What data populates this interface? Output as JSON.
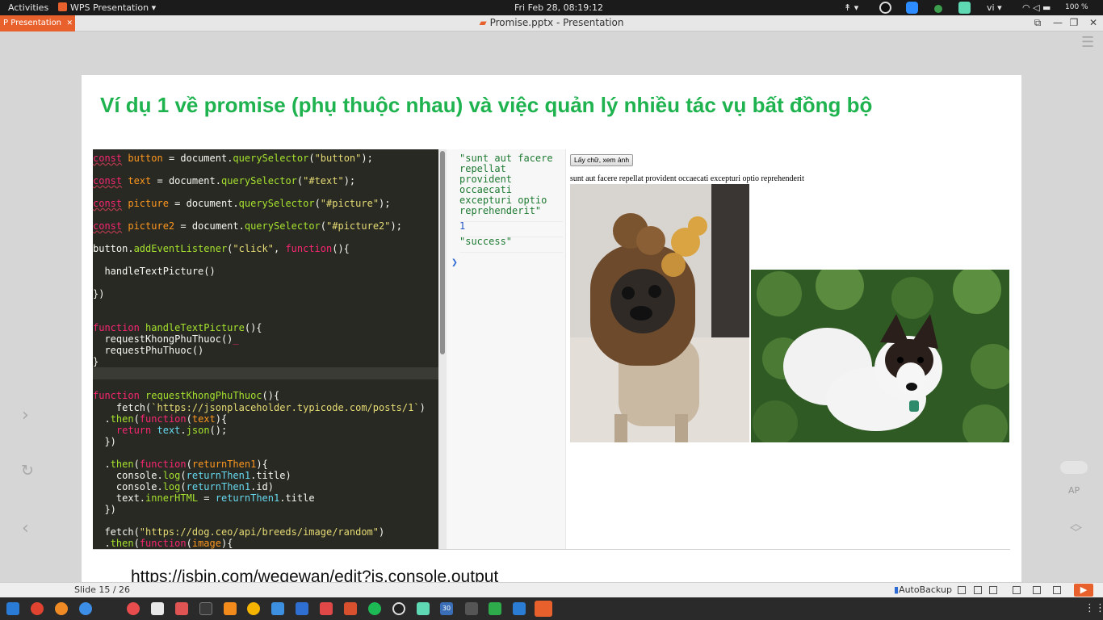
{
  "topbar": {
    "activities": "Activities",
    "app_menu": "WPS Presentation ▾",
    "clock": "Fri Feb 28, 08:19:12",
    "language": "vi ▾",
    "battery": "100 %"
  },
  "titlebar": {
    "app_tab": "Presentation",
    "doc_title": "Promise.pptx - Presentation"
  },
  "slide": {
    "title": "Ví dụ 1 về promise (phụ thuộc nhau) và việc quản lý nhiều tác vụ bất đồng bộ",
    "link": "https://jsbin.com/weqewan/edit?js,console,output"
  },
  "console": {
    "entries": [
      "\"sunt aut facere repellat provident occaecati excepturi optio reprehenderit\"",
      "1",
      "\"success\""
    ]
  },
  "output": {
    "button_label": "Lấy chữ, xem ảnh",
    "text": "sunt aut facere repellat provident occaecati excepturi optio reprehenderit"
  },
  "sidebar": {
    "ap_label": "AP"
  },
  "statusbar": {
    "slide_counter": "Slide 15 / 26",
    "autobackup": "AutoBackup"
  },
  "taskbar": {
    "calendar_day": "30"
  },
  "colors": {
    "title_green": "#1fb34f",
    "wps_orange": "#e8612c",
    "editor_bg": "#282923"
  }
}
